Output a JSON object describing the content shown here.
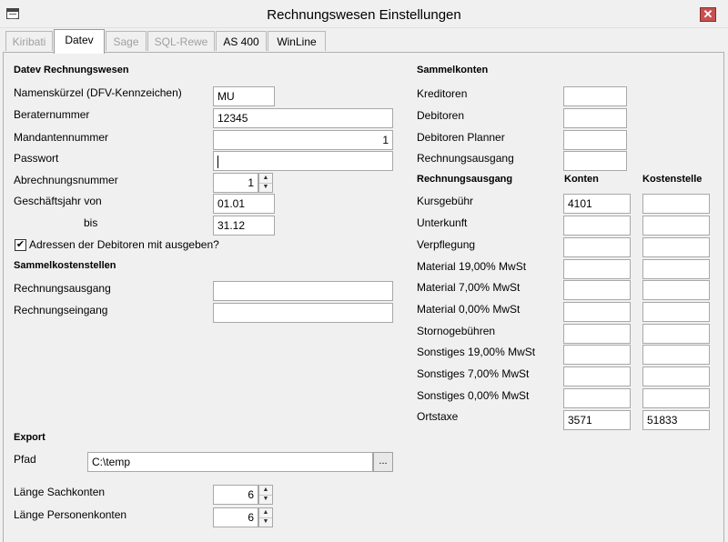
{
  "window": {
    "title": "Rechnungswesen Einstellungen",
    "close_glyph": "✕",
    "icon": "table-icon"
  },
  "tabs": [
    {
      "label": "Kiribati",
      "state": "disabled"
    },
    {
      "label": "Datev",
      "state": "active"
    },
    {
      "label": "Sage",
      "state": "disabled"
    },
    {
      "label": "SQL-Rewe",
      "state": "disabled"
    },
    {
      "label": "AS 400",
      "state": "enabled"
    },
    {
      "label": "WinLine",
      "state": "enabled"
    }
  ],
  "datev": {
    "heading": "Datev Rechnungswesen",
    "namenskuerzel": {
      "label": "Namenskürzel (DFV-Kennzeichen)",
      "value": "MU"
    },
    "beraternummer": {
      "label": "Beraternummer",
      "value": "12345"
    },
    "mandantennummer": {
      "label": "Mandantennummer",
      "value": "1"
    },
    "passwort": {
      "label": "Passwort",
      "value": ""
    },
    "abrechnungsnummer": {
      "label": "Abrechnungsnummer",
      "value": "1"
    },
    "geschaeftsjahr_von": {
      "label": "Geschäftsjahr von",
      "value": "01.01"
    },
    "geschaeftsjahr_bis": {
      "label": "bis",
      "value": "31.12"
    },
    "adressen_checkbox": {
      "label": "Adressen der Debitoren mit ausgeben?",
      "checked": true,
      "glyph": "✔"
    }
  },
  "sammelkostenstellen": {
    "heading": "Sammelkostenstellen",
    "rechnungsausgang": {
      "label": "Rechnungsausgang",
      "value": ""
    },
    "rechnungseingang": {
      "label": "Rechnungseingang",
      "value": ""
    }
  },
  "export": {
    "heading": "Export",
    "pfad": {
      "label": "Pfad",
      "value": "C:\\temp",
      "browse_label": "..."
    },
    "laenge_sachkonten": {
      "label": "Länge Sachkonten",
      "value": "6"
    },
    "laenge_personenkonten": {
      "label": "Länge Personenkonten",
      "value": "6"
    }
  },
  "sammelkonten": {
    "heading": "Sammelkonten",
    "kreditoren": {
      "label": "Kreditoren",
      "value": ""
    },
    "debitoren": {
      "label": "Debitoren",
      "value": ""
    },
    "debitoren_planner": {
      "label": "Debitoren Planner",
      "value": ""
    },
    "rechnungsausgang": {
      "label": "Rechnungsausgang",
      "value": ""
    }
  },
  "rechnungsausgang_table": {
    "heading": "Rechnungsausgang",
    "col_konten": "Konten",
    "col_kostenstelle": "Kostenstelle",
    "rows": [
      {
        "label": "Kursgebühr",
        "konten": "4101",
        "kostenstelle": ""
      },
      {
        "label": "Unterkunft",
        "konten": "",
        "kostenstelle": ""
      },
      {
        "label": "Verpflegung",
        "konten": "",
        "kostenstelle": ""
      },
      {
        "label": "Material 19,00% MwSt",
        "konten": "",
        "kostenstelle": ""
      },
      {
        "label": "Material 7,00% MwSt",
        "konten": "",
        "kostenstelle": ""
      },
      {
        "label": "Material 0,00% MwSt",
        "konten": "",
        "kostenstelle": ""
      },
      {
        "label": "Stornogebühren",
        "konten": "",
        "kostenstelle": ""
      },
      {
        "label": "Sonstiges 19,00% MwSt",
        "konten": "",
        "kostenstelle": ""
      },
      {
        "label": "Sonstiges 7,00% MwSt",
        "konten": "",
        "kostenstelle": ""
      },
      {
        "label": "Sonstiges 0,00% MwSt",
        "konten": "",
        "kostenstelle": ""
      },
      {
        "label": "Ortstaxe",
        "konten": "3571",
        "kostenstelle": "51833"
      }
    ]
  }
}
